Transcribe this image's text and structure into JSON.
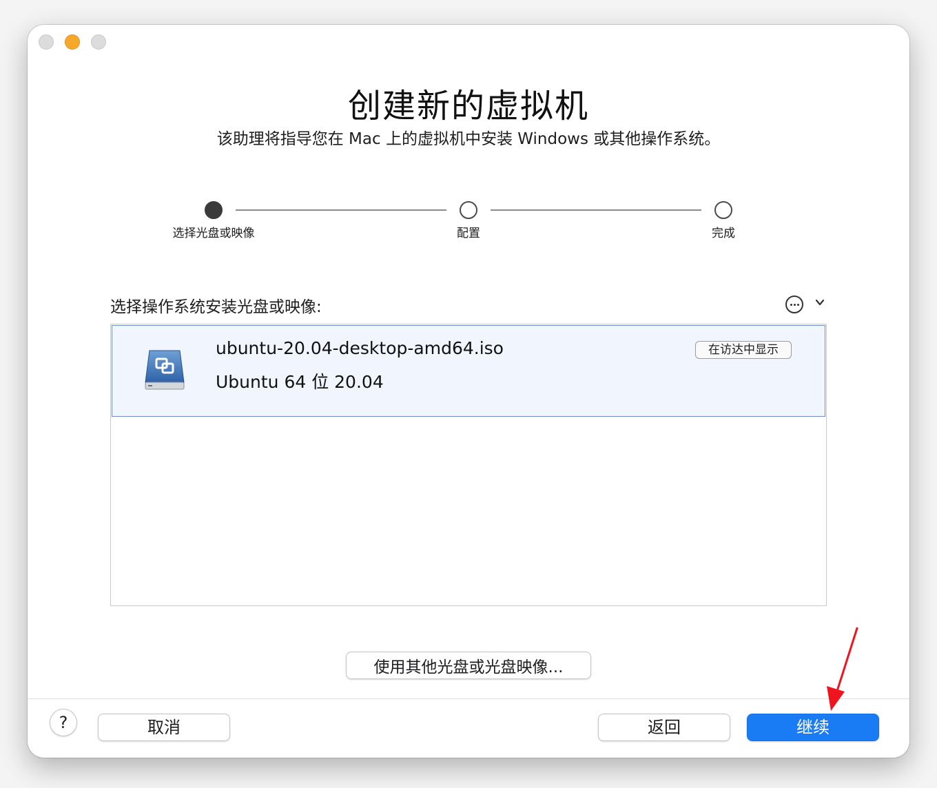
{
  "window": {
    "title": "创建新的虚拟机",
    "subtitle": "该助理将指导您在 Mac 上的虚拟机中安装 Windows 或其他操作系统。"
  },
  "steps": [
    {
      "label": "选择光盘或映像",
      "state": "active"
    },
    {
      "label": "配置",
      "state": "pending"
    },
    {
      "label": "完成",
      "state": "pending"
    }
  ],
  "section": {
    "label": "选择操作系统安装光盘或映像:"
  },
  "media_list": {
    "items": [
      {
        "name": "ubuntu-20.04-desktop-amd64.iso",
        "version": "Ubuntu 64 位 20.04",
        "action_label": "在访达中显示",
        "icon": "disk-image-icon"
      }
    ]
  },
  "buttons": {
    "other_media": "使用其他光盘或光盘映像...",
    "help": "?",
    "cancel": "取消",
    "back": "返回",
    "continue": "继续"
  },
  "colors": {
    "accent": "#1a7cf5",
    "selection_bg": "#f1f5fd",
    "annotation_arrow": "#f0141e",
    "minimize_light": "#f6a82b"
  },
  "icons": {
    "more": "ellipsis-circle-icon",
    "dropdown": "chevron-down-icon"
  }
}
